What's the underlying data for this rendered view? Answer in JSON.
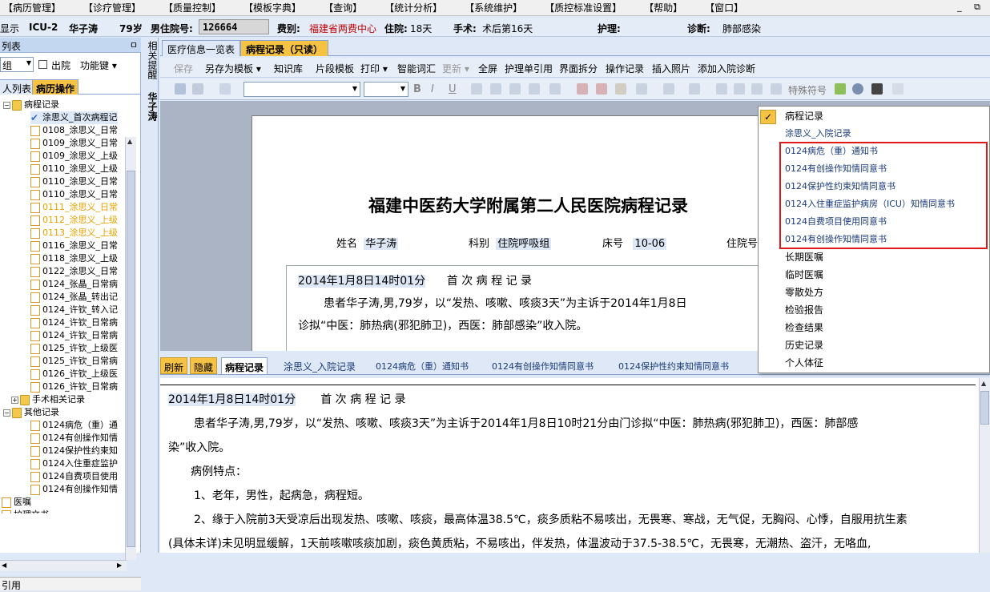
{
  "menu": [
    "【病历管理】",
    "【诊疗管理】",
    "【质量控制】",
    "【模板字典】",
    "【查询】",
    "【统计分析】",
    "【系统维护】",
    "【质控标准设置】",
    "【帮助】",
    "【窗口】"
  ],
  "window_controls": "_ ⧉",
  "patient": {
    "show": "显示",
    "ward": "ICU-2",
    "name": "华子涛",
    "age": "79岁",
    "gender_id_label": "男住院号:",
    "id": "126664",
    "fee_label": "费别:",
    "fee": "福建省两费中心",
    "stay_label": "住院:",
    "stay": "18天",
    "surgery_label": "手术:",
    "surgery": "术后第16天",
    "nursing_label": "护理:",
    "diag_label": "诊断:",
    "diag": "肺部感染"
  },
  "left": {
    "header": "列表",
    "pin": "ㅁ",
    "select_value": "组",
    "out_label": "出院",
    "func_label": "功能键",
    "tabs": [
      "人列表",
      "病历操作"
    ],
    "tree": {
      "root": "病程记录",
      "items": [
        "涂思义_首次病程记",
        "0108_涂思义_日常",
        "0109_涂思义_日常",
        "0109_涂思义_上级",
        "0110_涂思义_上级",
        "0110_涂思义_日常",
        "0110_涂思义_日常",
        "0111_涂思义_日常",
        "0112_涂思义_上级",
        "0113_涂思义_上级",
        "0116_涂思义_日常",
        "0118_涂思义_上级",
        "0122_涂思义_日常",
        "0124_张晶_日常病",
        "0124_张晶_转出记",
        "0124_许钦_转入记",
        "0124_许钦_日常病",
        "0124_许钦_日常病",
        "0125_许钦_上级医",
        "0125_许钦_日常病",
        "0126_许钦_上级医",
        "0126_许钦_日常病"
      ],
      "surgery_folder": "手术相关记录",
      "other_folder": "其他记录",
      "other_items": [
        "0124病危（重）通",
        "0124有创操作知情",
        "0124保护性约束知",
        "0124入住重症监护",
        "0124自费项目使用",
        "0124有创操作知情"
      ],
      "orders": "医嘱",
      "nursing": "护理文书"
    },
    "status": "引用"
  },
  "sidetabs": [
    "相关提醒",
    "华子涛"
  ],
  "doc_tabs": [
    "医疗信息一览表",
    "病程记录（只读）"
  ],
  "toolbar1": [
    "保存",
    "另存为模板 ▾",
    "知识库",
    "片段模板",
    "打印 ▾",
    "智能词汇",
    "更新 ▾",
    "全屏",
    "护理单引用",
    "界面拆分",
    "操作记录",
    "插入照片",
    "添加入院诊断"
  ],
  "toolbar2_special": "特殊符号",
  "document": {
    "title": "福建中医药大学附属第二人民医院病程记录",
    "name_label": "姓名",
    "name": "华子涛",
    "dept_label": "科别",
    "dept": "住院呼吸组",
    "bed_label": "床号",
    "bed": "10-06",
    "admno_label": "住院号",
    "rec_date": "2014年1月8日14时01分",
    "rec_title": "首 次 病 程 记 录",
    "line1": "患者华子涛,男,79岁，以“发热、咳嗽、咳痰3天”为主诉于2014年1月8日",
    "line2": "诊拟“中医：肺热病(邪犯肺卫)，西医：肺部感染”收入院。"
  },
  "bottom_tabs": [
    "刷新",
    "隐藏",
    "病程记录",
    "涂思义_入院记录",
    "0124病危（重）通知书",
    "0124有创操作知情同意书",
    "0124保护性约束知情同意书"
  ],
  "lower": {
    "date": "2014年1月8日14时01分",
    "title": "首 次 病 程 记 录",
    "p1a": "患者华子涛,男,79岁，以“发热、咳嗽、咳痰3天”为主诉于2014年1月8日10时21分由门诊拟“中医：肺热病(邪犯肺卫)，西医：肺部感",
    "p1b": "染”收入院。",
    "p2": "病例特点：",
    "p3": "1、老年，男性，起病急，病程短。",
    "p4": "2、缘于入院前3天受凉后出现发热、咳嗽、咳痰，最高体温38.5℃，痰多质粘不易咳出，无畏寒、寒战，无气促，无胸闷、心悸，自服用抗生素",
    "p5": "(具体未详)未见明显缓解，1天前咳嗽咳痰加剧，痰色黄质粘，不易咳出，伴发热，体温波动于37.5-38.5℃，无畏寒，无潮热、盗汗，无咯血,"
  },
  "popup": {
    "check": "✓",
    "items": [
      "病程记录",
      "涂思义_入院记录",
      "0124病危（重）通知书",
      "0124有创操作知情同意书",
      "0124保护性约束知情同意书",
      "0124入住重症监护病房（ICU）知情同意书",
      "0124自费项目使用同意书",
      "0124有创操作知情同意书",
      "长期医嘱",
      "临时医嘱",
      "零散处方",
      "检验报告",
      "检查结果",
      "历史记录",
      "个人体征"
    ]
  }
}
